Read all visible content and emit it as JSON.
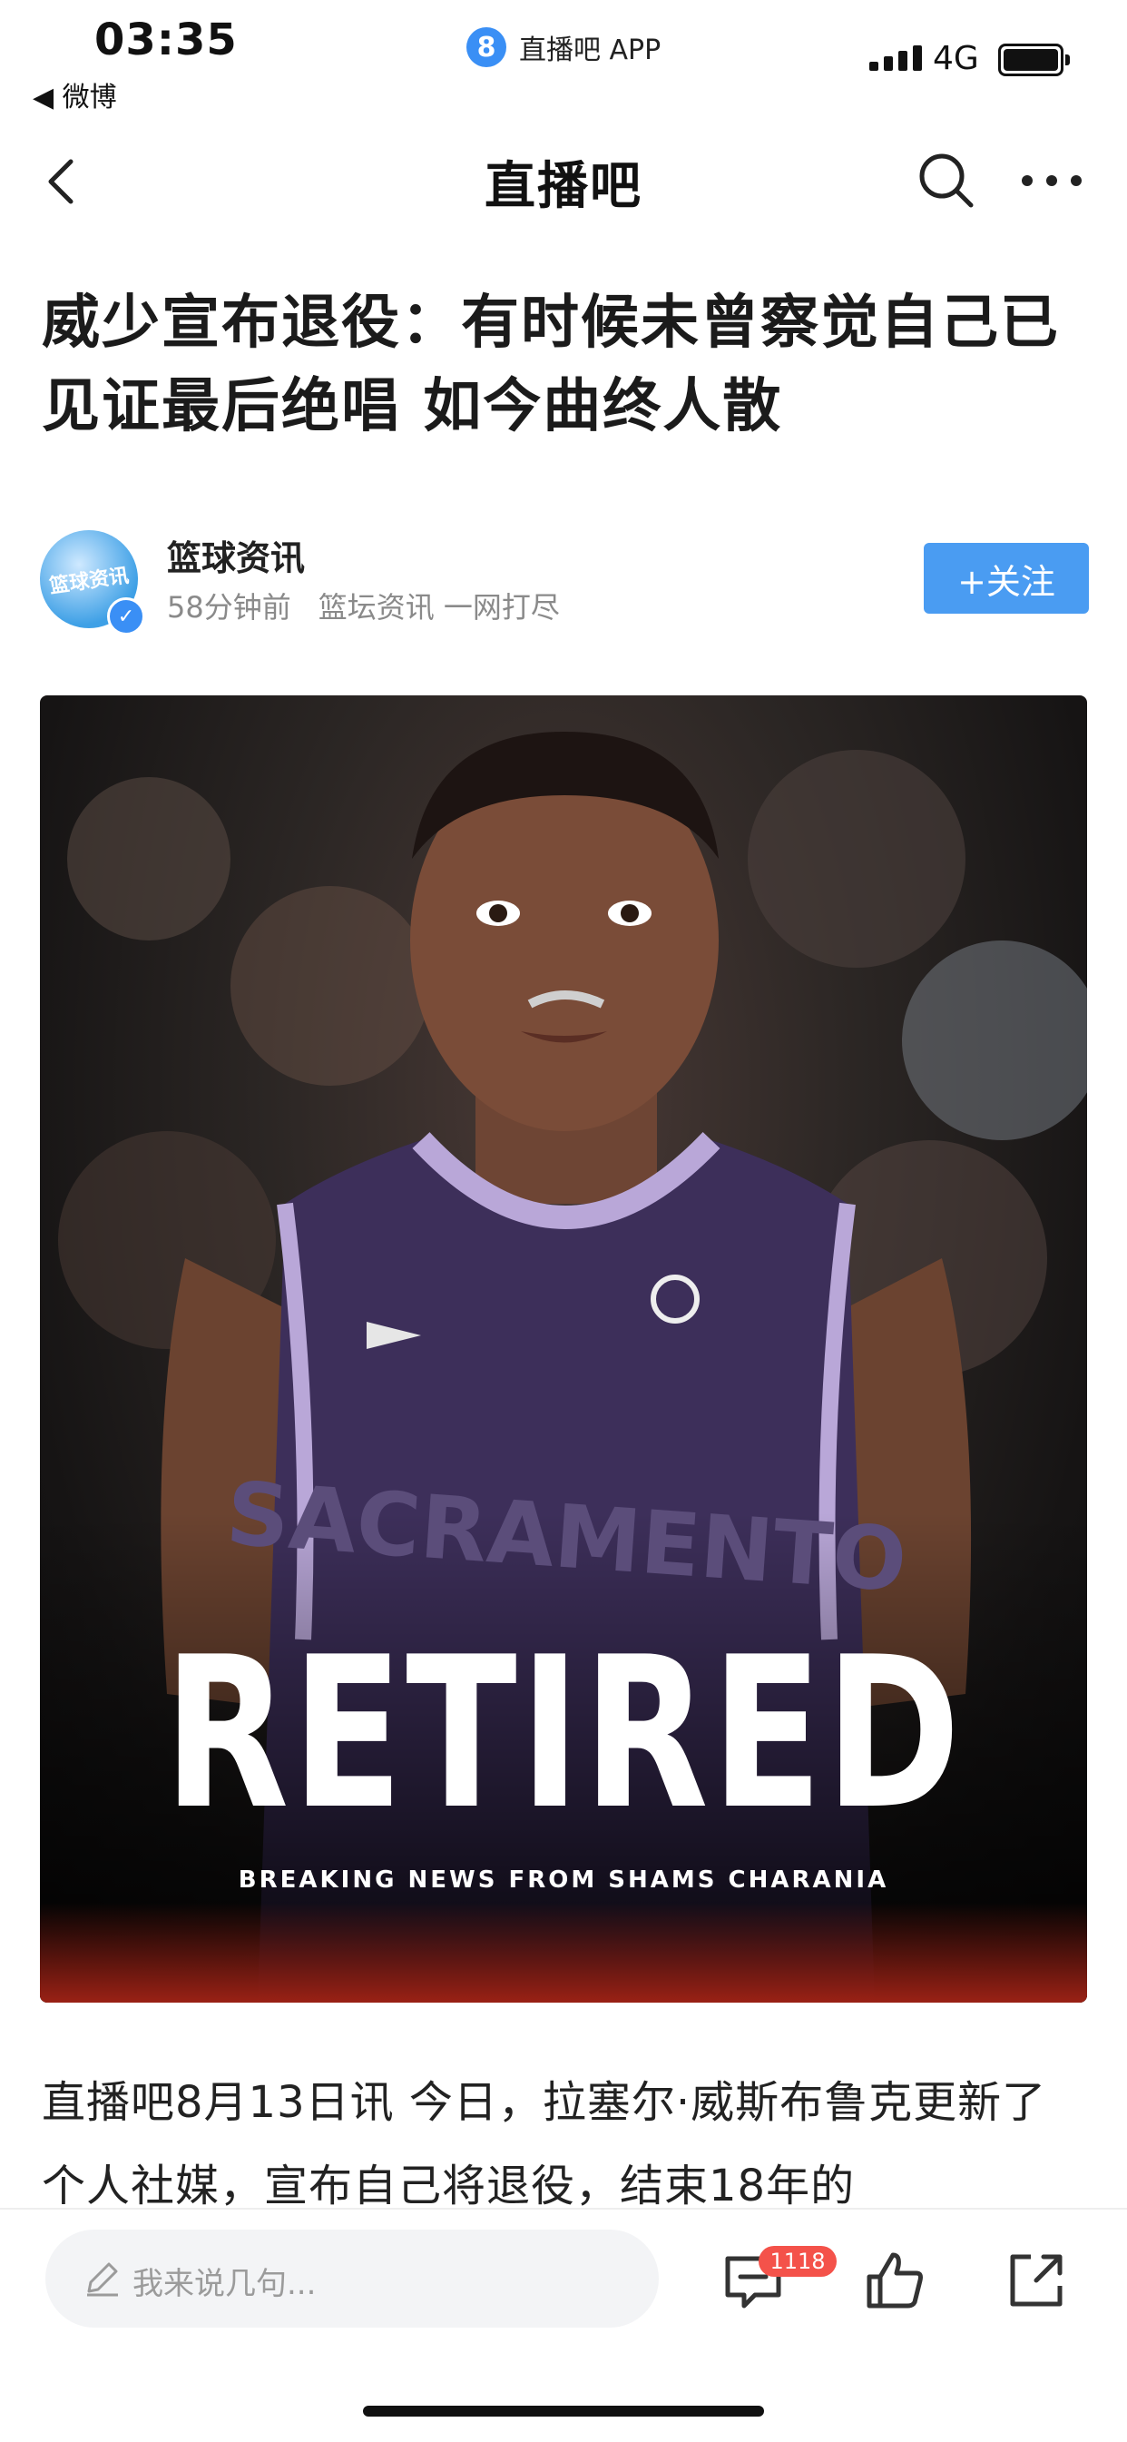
{
  "status_bar": {
    "time": "03:35",
    "back_to_app": "◀ 微博",
    "app_badge_letter": "8",
    "app_name": "直播吧 APP",
    "network": "4G"
  },
  "nav": {
    "title": "直播吧",
    "icons": [
      "back-chevron-icon",
      "search-icon",
      "more-dots-icon"
    ]
  },
  "article": {
    "headline": "威少宣布退役：有时候未曾察觉自己已见证最后绝唱 如今曲终人散",
    "author": {
      "name": "篮球资讯",
      "avatar_text": "篮球资讯",
      "time_ago": "58分钟前",
      "tagline": "篮坛资讯 一网打尽",
      "follow_label": "+关注"
    },
    "hero_image": {
      "jersey_text": "SACRAMENTO",
      "overlay_title": "RETIRED",
      "overlay_subtitle": "BREAKING NEWS FROM SHAMS CHARANIA"
    },
    "body": "直播吧8月13日讯 今日，拉塞尔·威斯布鲁克更新了个人社媒，宣布自己将退役，结束18年的"
  },
  "bottom_bar": {
    "comment_placeholder": "我来说几句...",
    "comment_count": "1118",
    "icons": [
      "pencil-icon",
      "comment-icon",
      "like-thumb-icon",
      "share-icon"
    ]
  },
  "colors": {
    "accent_blue": "#4a9cf2",
    "badge_red": "#f4524a"
  }
}
